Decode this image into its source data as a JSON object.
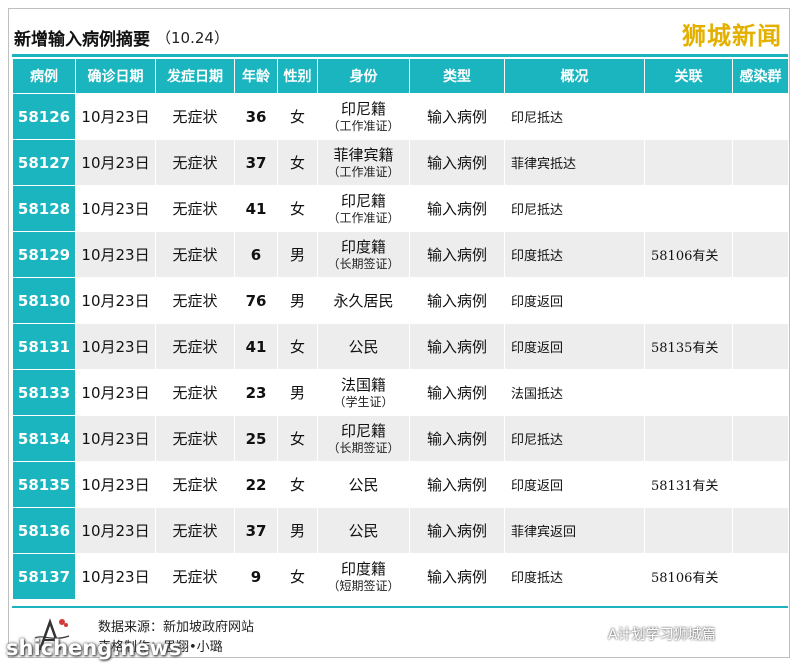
{
  "header": {
    "title": "新增输入病例摘要",
    "date": "（10.24）",
    "brand": "狮城新闻"
  },
  "columns": [
    "病例",
    "确诊日期",
    "发症日期",
    "年龄",
    "性别",
    "身份",
    "类型",
    "概况",
    "关联",
    "感染群"
  ],
  "rows": [
    {
      "id": "58126",
      "confirm": "10月23日",
      "onset": "无症状",
      "age": "36",
      "sex": "女",
      "identity": "印尼籍",
      "identity_sub": "（工作准证）",
      "type": "输入病例",
      "status": "印尼抵达",
      "link": "",
      "cluster": ""
    },
    {
      "id": "58127",
      "confirm": "10月23日",
      "onset": "无症状",
      "age": "37",
      "sex": "女",
      "identity": "菲律宾籍",
      "identity_sub": "（工作准证）",
      "type": "输入病例",
      "status": "菲律宾抵达",
      "link": "",
      "cluster": ""
    },
    {
      "id": "58128",
      "confirm": "10月23日",
      "onset": "无症状",
      "age": "41",
      "sex": "女",
      "identity": "印尼籍",
      "identity_sub": "（工作准证）",
      "type": "输入病例",
      "status": "印尼抵达",
      "link": "",
      "cluster": ""
    },
    {
      "id": "58129",
      "confirm": "10月23日",
      "onset": "无症状",
      "age": "6",
      "sex": "男",
      "identity": "印度籍",
      "identity_sub": "（长期签证）",
      "type": "输入病例",
      "status": "印度抵达",
      "link": "58106有关",
      "cluster": ""
    },
    {
      "id": "58130",
      "confirm": "10月23日",
      "onset": "无症状",
      "age": "76",
      "sex": "男",
      "identity": "永久居民",
      "identity_sub": "",
      "type": "输入病例",
      "status": "印度返回",
      "link": "",
      "cluster": ""
    },
    {
      "id": "58131",
      "confirm": "10月23日",
      "onset": "无症状",
      "age": "41",
      "sex": "女",
      "identity": "公民",
      "identity_sub": "",
      "type": "输入病例",
      "status": "印度返回",
      "link": "58135有关",
      "cluster": ""
    },
    {
      "id": "58133",
      "confirm": "10月23日",
      "onset": "无症状",
      "age": "23",
      "sex": "男",
      "identity": "法国籍",
      "identity_sub": "（学生证）",
      "type": "输入病例",
      "status": "法国抵达",
      "link": "",
      "cluster": ""
    },
    {
      "id": "58134",
      "confirm": "10月23日",
      "onset": "无症状",
      "age": "25",
      "sex": "女",
      "identity": "印尼籍",
      "identity_sub": "（长期签证）",
      "type": "输入病例",
      "status": "印尼抵达",
      "link": "",
      "cluster": ""
    },
    {
      "id": "58135",
      "confirm": "10月23日",
      "onset": "无症状",
      "age": "22",
      "sex": "女",
      "identity": "公民",
      "identity_sub": "",
      "type": "输入病例",
      "status": "印度返回",
      "link": "58131有关",
      "cluster": ""
    },
    {
      "id": "58136",
      "confirm": "10月23日",
      "onset": "无症状",
      "age": "37",
      "sex": "男",
      "identity": "公民",
      "identity_sub": "",
      "type": "输入病例",
      "status": "菲律宾返回",
      "link": "",
      "cluster": ""
    },
    {
      "id": "58137",
      "confirm": "10月23日",
      "onset": "无症状",
      "age": "9",
      "sex": "女",
      "identity": "印度籍",
      "identity_sub": "（短期签证）",
      "type": "输入病例",
      "status": "印度抵达",
      "link": "58106有关",
      "cluster": ""
    }
  ],
  "footer": {
    "source": "数据来源：新加坡政府网站",
    "maker": "表格制作：思翔•小璐",
    "watermark": "A计划学习狮城篇",
    "site": "shicheng.news"
  },
  "colors": {
    "accent": "#1ab5bf",
    "brand": "#e3b000",
    "row_alt": "#ededed"
  }
}
